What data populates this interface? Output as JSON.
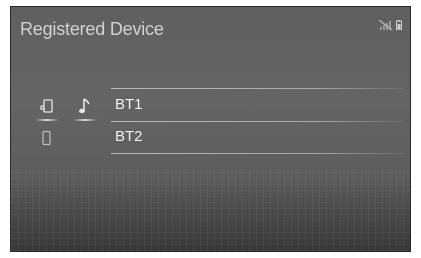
{
  "screen": {
    "title": "Registered Device"
  },
  "status_bar": {
    "icons": [
      "no-signal-icon",
      "battery-icon"
    ]
  },
  "devices": [
    {
      "name": "BT1",
      "icons": [
        "phone-icon",
        "audio-icon"
      ],
      "phone_connected": true,
      "audio_connected": true
    },
    {
      "name": "BT2",
      "icons": [
        "phone-icon"
      ],
      "phone_connected": false,
      "audio_connected": false
    }
  ],
  "colors": {
    "background": "#606060",
    "title_text": "#d2d2d2",
    "item_text": "#f0f0f0"
  }
}
